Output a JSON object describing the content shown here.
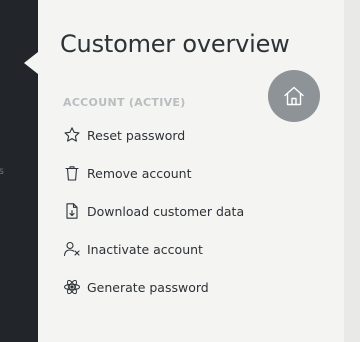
{
  "sidebar": {
    "partial_label": "is"
  },
  "panel": {
    "title": "Customer overview",
    "home_icon": "home-icon",
    "section_header": "ACCOUNT (ACTIVE)",
    "items": [
      {
        "label": "Reset password",
        "icon": "star-icon"
      },
      {
        "label": "Remove account",
        "icon": "trash-icon"
      },
      {
        "label": "Download customer data",
        "icon": "file-download-icon"
      },
      {
        "label": "Inactivate account",
        "icon": "user-remove-icon"
      },
      {
        "label": "Generate password",
        "icon": "atom-icon"
      }
    ]
  },
  "colors": {
    "sidebar_bg": "#22262b",
    "panel_bg": "#f4f4f2",
    "home_button_bg": "#8e9397",
    "section_header": "#b9bdc0",
    "text": "#2d3238"
  }
}
